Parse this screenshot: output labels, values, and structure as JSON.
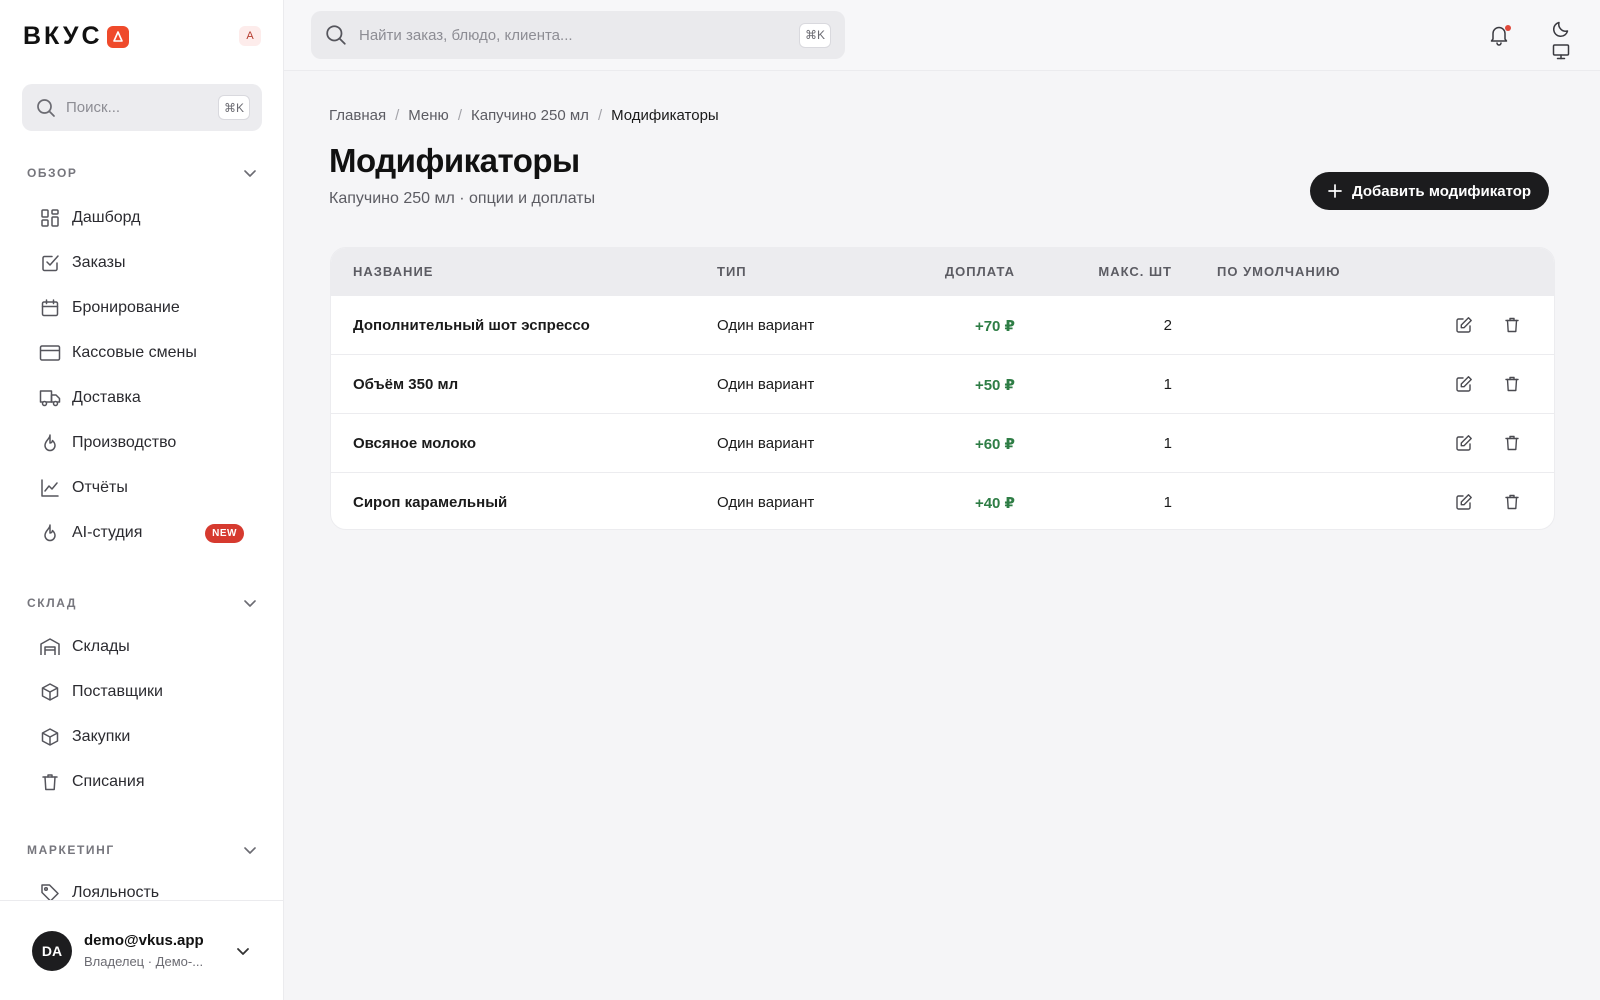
{
  "app": {
    "logo_text": "ВКУС",
    "lang_badge": "A"
  },
  "sidebar": {
    "search_placeholder": "Поиск...",
    "search_shortcut": "⌘K",
    "sections": [
      {
        "label": "ОБЗОР",
        "items": [
          {
            "label": "Дашборд",
            "icon": "dashboard-icon"
          },
          {
            "label": "Заказы",
            "icon": "checkbox-icon"
          },
          {
            "label": "Бронирование",
            "icon": "calendar-icon"
          },
          {
            "label": "Кассовые смены",
            "icon": "credit-card-icon"
          },
          {
            "label": "Доставка",
            "icon": "truck-icon"
          },
          {
            "label": "Производство",
            "icon": "flame-icon"
          },
          {
            "label": "Отчёты",
            "icon": "chart-line-icon"
          },
          {
            "label": "AI-студия",
            "icon": "flame-icon",
            "badge": "NEW"
          }
        ]
      },
      {
        "label": "СКЛАД",
        "items": [
          {
            "label": "Склады",
            "icon": "warehouse-icon"
          },
          {
            "label": "Поставщики",
            "icon": "box-icon"
          },
          {
            "label": "Закупки",
            "icon": "box-icon"
          },
          {
            "label": "Списания",
            "icon": "trash-icon"
          }
        ]
      },
      {
        "label": "МАРКЕТИНГ",
        "items": [
          {
            "label": "Лояльность",
            "icon": "tag-icon"
          }
        ]
      }
    ],
    "user": {
      "initials": "DA",
      "email": "demo@vkus.app",
      "role": "Владелец · Демо-..."
    }
  },
  "topbar": {
    "search_placeholder": "Найти заказ, блюдо, клиента...",
    "search_shortcut": "⌘K"
  },
  "breadcrumb": [
    "Главная",
    "Меню",
    "Капучино 250 мл",
    "Модификаторы"
  ],
  "page": {
    "title": "Модификаторы",
    "subtitle": "Капучино 250 мл · опции и доплаты",
    "add_button_label": "Добавить модификатор"
  },
  "table": {
    "columns": [
      "НАЗВАНИЕ",
      "ТИП",
      "ДОПЛАТА",
      "МАКС. ШТ",
      "ПО УМОЛЧАНИЮ"
    ],
    "rows": [
      {
        "name": "Дополнительный шот эспрессо",
        "type": "Один вариант",
        "price": "+70 ₽",
        "max": "2"
      },
      {
        "name": "Объём 350 мл",
        "type": "Один вариант",
        "price": "+50 ₽",
        "max": "1"
      },
      {
        "name": "Овсяное молоко",
        "type": "Один вариант",
        "price": "+60 ₽",
        "max": "1"
      },
      {
        "name": "Сироп карамельный",
        "type": "Один вариант",
        "price": "+40 ₽",
        "max": "1"
      }
    ]
  },
  "colors": {
    "brand": "#ef4a2b",
    "price_green": "#2e7d45",
    "primary_button": "#1c1c1e",
    "badge_red": "#d63a2f"
  }
}
